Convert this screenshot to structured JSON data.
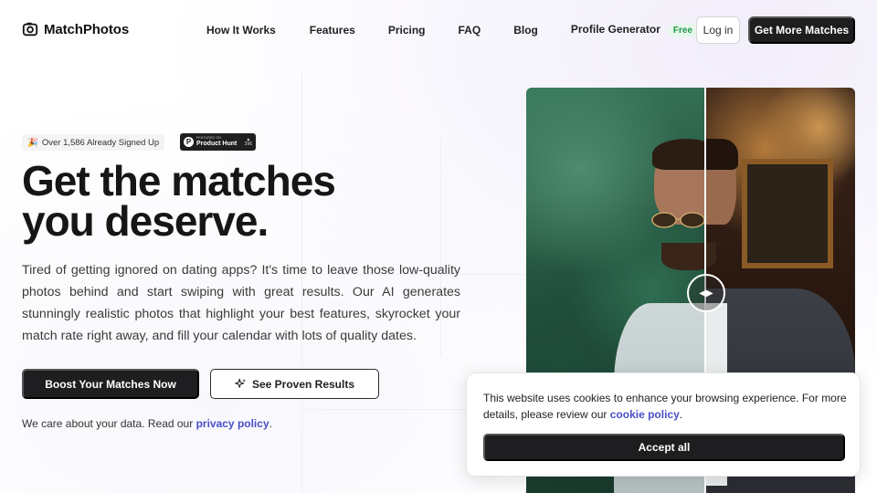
{
  "brand": {
    "name": "MatchPhotos",
    "logo_icon": "camera-icon"
  },
  "nav": {
    "links": [
      {
        "label": "How It Works"
      },
      {
        "label": "Features"
      },
      {
        "label": "Pricing"
      },
      {
        "label": "FAQ"
      },
      {
        "label": "Blog"
      },
      {
        "label": "Profile Generator",
        "badge": "Free"
      }
    ],
    "login_label": "Log in",
    "cta_label": "Get More Matches"
  },
  "hero": {
    "signup_badge": {
      "emoji": "🎉",
      "text": "Over 1,586 Already Signed Up"
    },
    "product_hunt": {
      "small": "FEATURED ON",
      "big": "Product Hunt",
      "letter": "P",
      "upvotes": "296"
    },
    "headline_line1": "Get the matches",
    "headline_line2": "you deserve.",
    "description": "Tired of getting ignored on dating apps? It's time to leave those low-quality photos behind and start swiping with great results. Our AI generates stunningly realistic photos that highlight your best features, skyrocket your match rate right away, and fill your calendar with lots of quality dates.",
    "primary_button": "Boost Your Matches Now",
    "secondary_button": "See Proven Results",
    "secondary_icon": "sparkle-icon",
    "privacy_text": "We care about your data. Read our",
    "privacy_link": "privacy policy",
    "privacy_end": "."
  },
  "comparison": {
    "handle_icon": "compare-arrows-icon"
  },
  "cookie_banner": {
    "text": "This website uses cookies to enhance your browsing experience. For more details, please review our",
    "link": "cookie policy",
    "end": ".",
    "accept_label": "Accept all"
  },
  "colors": {
    "dark": "#1e1e20",
    "link": "#4a4fc7",
    "free_badge_bg": "#e8f7ec",
    "free_badge_text": "#1f9d4c"
  }
}
